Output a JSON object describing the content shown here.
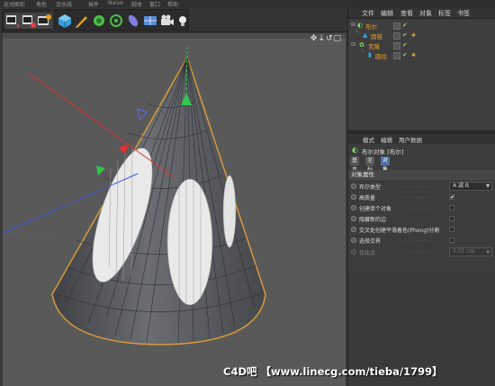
{
  "top_menu": [
    "运动图形",
    "角色",
    "流水线",
    "插件",
    "Naive",
    "脚本",
    "窗口",
    "帮助"
  ],
  "toolbar": {
    "groups": [
      {
        "name": "render-group",
        "buttons": [
          "render-region-icon",
          "render-view-icon",
          "render-settings-icon"
        ]
      },
      {
        "name": "object-group",
        "buttons": [
          "cube-icon",
          "pen-icon",
          "subdivision-icon",
          "cloner-icon",
          "deformer-icon",
          "floor-icon",
          "camera-icon",
          "light-icon"
        ]
      }
    ]
  },
  "viewport": {
    "nav_icons": "✥↓↺▢"
  },
  "object_manager": {
    "menu": [
      "文件",
      "编辑",
      "查看",
      "对象",
      "标签",
      "书签"
    ],
    "rows": [
      {
        "indent": 0,
        "icon": "boole-icon",
        "name": "布尔"
      },
      {
        "indent": 1,
        "icon": "cone-icon",
        "name": "圆锥"
      },
      {
        "indent": 1,
        "icon": "cloner-icon",
        "name": "克隆"
      },
      {
        "indent": 2,
        "icon": "cylinder-icon",
        "name": "圆柱"
      }
    ]
  },
  "attribute_manager": {
    "menu": [
      "模式",
      "编辑",
      "用户数据"
    ],
    "title": "布尔对象 [布尔]",
    "tabs": [
      "基本",
      "坐标",
      "对象"
    ],
    "active_tab": "对象",
    "section": "对象属性",
    "properties": [
      {
        "label": "布尔类型",
        "type": "select",
        "value": "A 减 B"
      },
      {
        "label": "高质量",
        "type": "check",
        "checked": true
      },
      {
        "label": "创建单个对象",
        "type": "check",
        "checked": false
      },
      {
        "label": "隐藏新的边",
        "type": "check",
        "checked": false
      },
      {
        "label": "交叉处创建平滑着色(Phong)分割",
        "type": "check",
        "checked": false
      },
      {
        "label": "选择交界",
        "type": "check",
        "checked": false
      },
      {
        "label": "优化点",
        "type": "field",
        "value": "0.01 cm",
        "disabled": true
      }
    ]
  },
  "watermark": "C4D吧 【www.linecg.com/tieba/1799】",
  "colors": {
    "accent_orange": "#e59a2c",
    "check_green": "#7fd46a",
    "tab_active": "#4a6ea8",
    "y_axis": "#2ec84a",
    "x_axis": "#e03030",
    "z_axis": "#3c58e0"
  }
}
